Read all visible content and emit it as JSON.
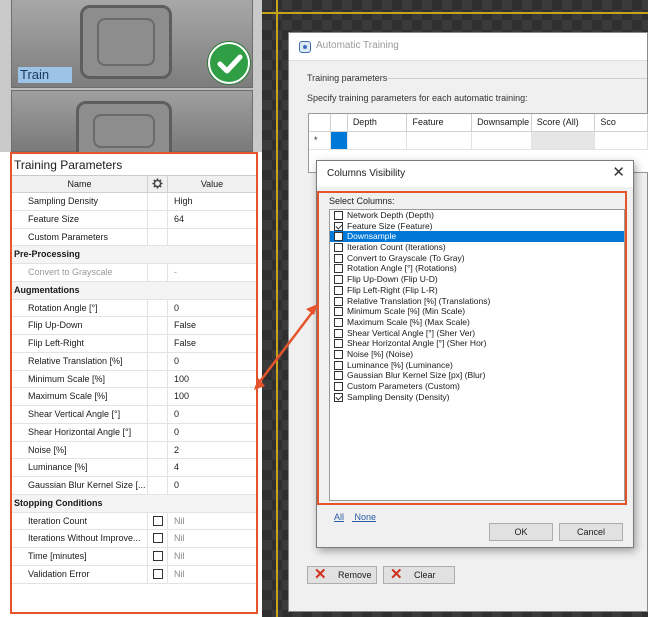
{
  "thumbnails": {
    "selected_label": "Train",
    "status_icon": "check-circle-icon"
  },
  "params": {
    "title": "Training Parameters",
    "headers": {
      "name": "Name",
      "value": "Value"
    },
    "rows": [
      {
        "name": "Sampling Density",
        "value": "High"
      },
      {
        "name": "Feature Size",
        "value": "64"
      },
      {
        "name": "Custom Parameters",
        "value": ""
      },
      {
        "section": "Pre-Processing"
      },
      {
        "name": "Convert to Grayscale",
        "value": "-",
        "disabled": true
      },
      {
        "section": "Augmentations"
      },
      {
        "name": "Rotation Angle [°]",
        "value": "0"
      },
      {
        "name": "Flip Up-Down",
        "value": "False"
      },
      {
        "name": "Flip Left-Right",
        "value": "False"
      },
      {
        "name": "Relative Translation [%]",
        "value": "0"
      },
      {
        "name": "Minimum Scale [%]",
        "value": "100"
      },
      {
        "name": "Maximum Scale [%]",
        "value": "100"
      },
      {
        "name": "Shear Vertical Angle [°]",
        "value": "0"
      },
      {
        "name": "Shear Horizontal Angle [°]",
        "value": "0"
      },
      {
        "name": "Noise [%]",
        "value": "2"
      },
      {
        "name": "Luminance [%]",
        "value": "4"
      },
      {
        "name": "Gaussian Blur Kernel Size [...",
        "value": "0"
      },
      {
        "section": "Stopping Conditions"
      },
      {
        "name": "Iteration Count",
        "value": "Nil",
        "checkbox": true
      },
      {
        "name": "Iterations Without Improve...",
        "value": "Nil",
        "checkbox": true
      },
      {
        "name": "Time [minutes]",
        "value": "Nil",
        "checkbox": true
      },
      {
        "name": "Validation Error",
        "value": "Nil",
        "checkbox": true
      }
    ]
  },
  "auto_training": {
    "title": "Automatic Training",
    "group_label": "Training parameters",
    "description": "Specify training parameters for each automatic training:",
    "columns": [
      "",
      "",
      "Depth",
      "Feature",
      "Downsample",
      "Score (All)",
      "Sco"
    ],
    "new_row_marker": "*",
    "remove_label": "Remove",
    "clear_label": "Clear"
  },
  "columns_dialog": {
    "title": "Columns Visibility",
    "select_label": "Select Columns:",
    "items": [
      {
        "label": "Network Depth (Depth)",
        "checked": false
      },
      {
        "label": "Feature Size (Feature)",
        "checked": true
      },
      {
        "label": "Downsample",
        "checked": false,
        "selected": true
      },
      {
        "label": "Iteration Count (Iterations)",
        "checked": false
      },
      {
        "label": "Convert to Grayscale (To Gray)",
        "checked": false
      },
      {
        "label": "Rotation Angle [°] (Rotations)",
        "checked": false
      },
      {
        "label": "Flip Up-Down (Flip U-D)",
        "checked": false
      },
      {
        "label": "Flip Left-Right (Flip L-R)",
        "checked": false
      },
      {
        "label": "Relative Translation [%] (Translations)",
        "checked": false
      },
      {
        "label": "Minimum Scale [%] (Min Scale)",
        "checked": false
      },
      {
        "label": "Maximum Scale [%] (Max Scale)",
        "checked": false
      },
      {
        "label": "Shear Vertical Angle [°] (Sher Ver)",
        "checked": false
      },
      {
        "label": "Shear Horizontal Angle [°] (Sher Hor)",
        "checked": false
      },
      {
        "label": "Noise [%] (Noise)",
        "checked": false
      },
      {
        "label": "Luminance [%] (Luminance)",
        "checked": false
      },
      {
        "label": "Gaussian Blur Kernel Size [px] (Blur)",
        "checked": false
      },
      {
        "label": "Custom Parameters (Custom)",
        "checked": false
      },
      {
        "label": "Sampling Density (Density)",
        "checked": true
      }
    ],
    "all_label": "All",
    "none_label": "None",
    "ok_label": "OK",
    "cancel_label": "Cancel"
  },
  "colors": {
    "highlight": "#e5542b",
    "selection": "#0078d7",
    "success": "#2f9e44"
  }
}
